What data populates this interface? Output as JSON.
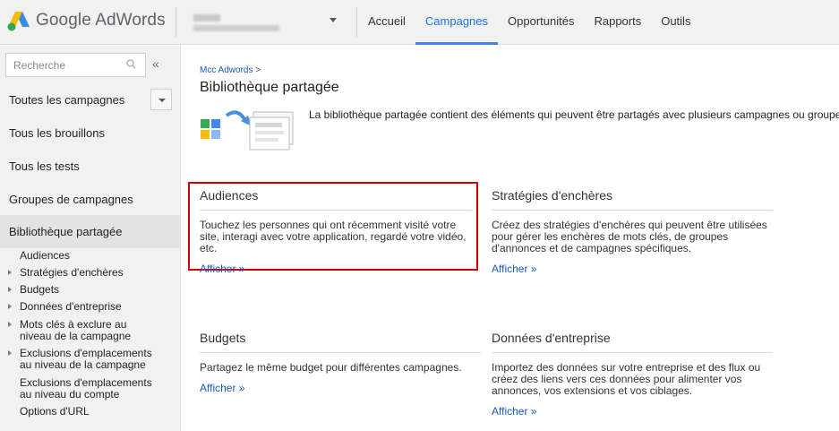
{
  "header": {
    "logo_text": "Google AdWords",
    "nav": [
      {
        "label": "Accueil",
        "active": false
      },
      {
        "label": "Campagnes",
        "active": true
      },
      {
        "label": "Opportunités",
        "active": false
      },
      {
        "label": "Rapports",
        "active": false
      },
      {
        "label": "Outils",
        "active": false
      }
    ]
  },
  "sidebar": {
    "search_placeholder": "Recherche",
    "collapse_glyph": "«",
    "items": [
      {
        "label": "Toutes les campagnes"
      },
      {
        "label": "Tous les brouillons"
      },
      {
        "label": "Tous les tests"
      },
      {
        "label": "Groupes de campagnes"
      },
      {
        "label": "Bibliothèque partagée",
        "active": true
      }
    ],
    "sub_items": [
      {
        "label": "Audiences",
        "expandable": false
      },
      {
        "label": "Stratégies d'enchères",
        "expandable": true
      },
      {
        "label": "Budgets",
        "expandable": true
      },
      {
        "label": "Données d'entreprise",
        "expandable": true
      },
      {
        "label": "Mots clés à exclure au niveau de la campagne",
        "expandable": true
      },
      {
        "label": "Exclusions d'emplacements au niveau de la campagne",
        "expandable": true
      },
      {
        "label": "Exclusions d'emplacements au niveau du compte",
        "expandable": false
      },
      {
        "label": "Options d'URL",
        "expandable": false
      }
    ]
  },
  "main": {
    "breadcrumb": "Mcc Adwords",
    "breadcrumb_sep": ">",
    "title": "Bibliothèque partagée",
    "intro": "La bibliothèque partagée contient des éléments qui peuvent être partagés avec plusieurs campagnes ou groupes de",
    "cards": [
      {
        "title": "Audiences",
        "desc": "Touchez les personnes qui ont récemment visité votre site, interagi avec votre application, regardé votre vidéo, etc.",
        "link": "Afficher »"
      },
      {
        "title": "Stratégies d'enchères",
        "desc": "Créez des stratégies d'enchères qui peuvent être utilisées pour gérer les enchères de mots clés, de groupes d'annonces et de campagnes spécifiques.",
        "link": "Afficher »"
      },
      {
        "title": "Budgets",
        "desc": "Partagez le même budget pour différentes campagnes.",
        "link": "Afficher »"
      },
      {
        "title": "Données d'entreprise",
        "desc": "Importez des données sur votre entreprise et des flux ou créez des liens vers ces données pour alimenter vos annonces, vos extensions et vos ciblages.",
        "link": "Afficher »"
      }
    ]
  },
  "colors": {
    "accent": "#4285f4",
    "link": "#1a5bb5",
    "highlight": "#d00000"
  }
}
